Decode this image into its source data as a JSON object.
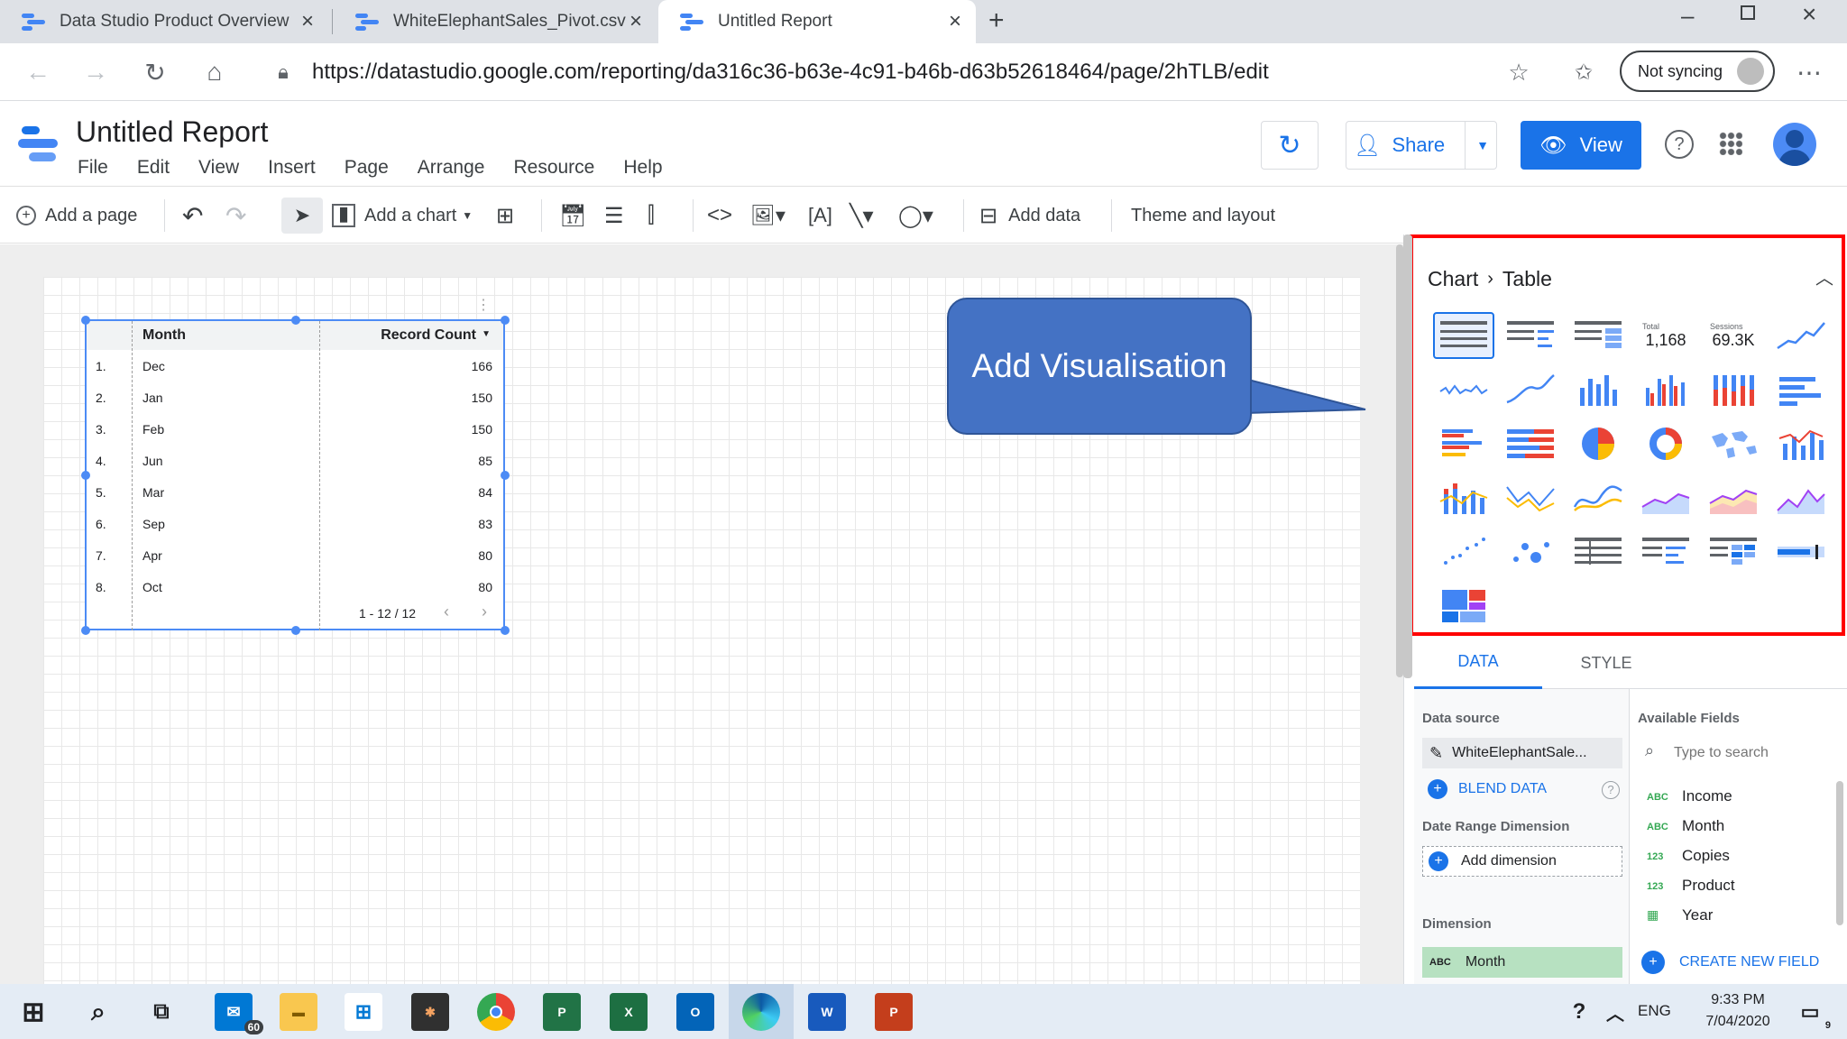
{
  "browser": {
    "tabs": [
      {
        "label": "Data Studio Product Overview"
      },
      {
        "label": "WhiteElephantSales_Pivot.csv"
      },
      {
        "label": "Untitled Report"
      }
    ],
    "url": "https://datastudio.google.com/reporting/da316c36-b63e-4c91-b46b-d63b52618464/page/2hTLB/edit",
    "sync_label": "Not syncing"
  },
  "app": {
    "title": "Untitled Report",
    "menus": [
      "File",
      "Edit",
      "View",
      "Insert",
      "Page",
      "Arrange",
      "Resource",
      "Help"
    ],
    "share_label": "Share",
    "view_label": "View"
  },
  "toolbar": {
    "add_page": "Add a page",
    "add_chart": "Add a chart",
    "add_data": "Add data",
    "theme_layout": "Theme and layout"
  },
  "table": {
    "headers": {
      "dim": "Month",
      "metric": "Record Count"
    },
    "rows": [
      {
        "idx": "1.",
        "month": "Dec",
        "count": "166"
      },
      {
        "idx": "2.",
        "month": "Jan",
        "count": "150"
      },
      {
        "idx": "3.",
        "month": "Feb",
        "count": "150"
      },
      {
        "idx": "4.",
        "month": "Jun",
        "count": "85"
      },
      {
        "idx": "5.",
        "month": "Mar",
        "count": "84"
      },
      {
        "idx": "6.",
        "month": "Sep",
        "count": "83"
      },
      {
        "idx": "7.",
        "month": "Apr",
        "count": "80"
      },
      {
        "idx": "8.",
        "month": "Oct",
        "count": "80"
      }
    ],
    "pagination": "1 - 12 / 12"
  },
  "callout": "Add Visualisation",
  "panel": {
    "breadcrumb_root": "Chart",
    "breadcrumb_current": "Table",
    "scorecard_total_label": "Total",
    "scorecard_total_value": "1,168",
    "scorecard_sessions_label": "Sessions",
    "scorecard_sessions_value": "69.3K",
    "tabs": {
      "data": "DATA",
      "style": "STYLE"
    },
    "data_source_label": "Data source",
    "data_source_name": "WhiteElephantSale...",
    "blend_data": "BLEND DATA",
    "date_range_label": "Date Range Dimension",
    "add_dimension": "Add dimension",
    "dimension_label": "Dimension",
    "dimension_value": "Month",
    "available_fields_label": "Available Fields",
    "search_placeholder": "Type to search",
    "fields": [
      {
        "type": "ABC",
        "name": "Income"
      },
      {
        "type": "ABC",
        "name": "Month"
      },
      {
        "type": "123",
        "name": "Copies"
      },
      {
        "type": "123",
        "name": "Product"
      },
      {
        "type": "cal",
        "name": "Year"
      }
    ],
    "create_field": "CREATE NEW FIELD"
  },
  "taskbar": {
    "mail_badge": "60",
    "time": "9:33 PM",
    "date": "7/04/2020",
    "lang": "ENG",
    "notif_count": "9"
  },
  "colors": {
    "accent": "#1a73e8",
    "callout": "#4472c4",
    "highlight": "#ff0000"
  }
}
